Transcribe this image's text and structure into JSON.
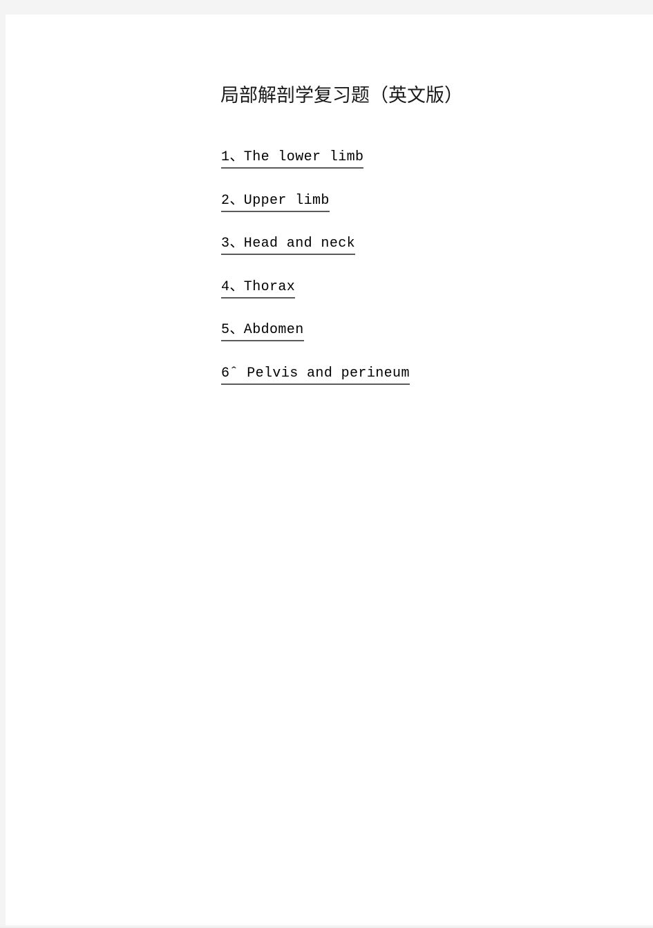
{
  "page": {
    "background_color": "#f4f4f4",
    "sheet_color": "#ffffff",
    "text_color": "#000000",
    "underline_color": "#595959"
  },
  "document": {
    "title": "局部解剖学复习题（英文版）",
    "toc": {
      "items": [
        {
          "number": "1",
          "separator": "、",
          "label": "The lower limb",
          "full": "1、The lower limb"
        },
        {
          "number": "2",
          "separator": "、",
          "label": "Upper limb",
          "full": "2、Upper limb"
        },
        {
          "number": "3",
          "separator": "、",
          "label": "Head and neck",
          "full": "3、Head and neck"
        },
        {
          "number": "4",
          "separator": "、",
          "label": "Thorax",
          "full": "4、Thorax"
        },
        {
          "number": "5",
          "separator": "、",
          "label": "Abdomen",
          "full": "5、Abdomen"
        },
        {
          "number": "6",
          "separator": "ˆ",
          "label": "Pelvis and perineum",
          "full": "6ˆ Pelvis and perineum"
        }
      ]
    }
  }
}
